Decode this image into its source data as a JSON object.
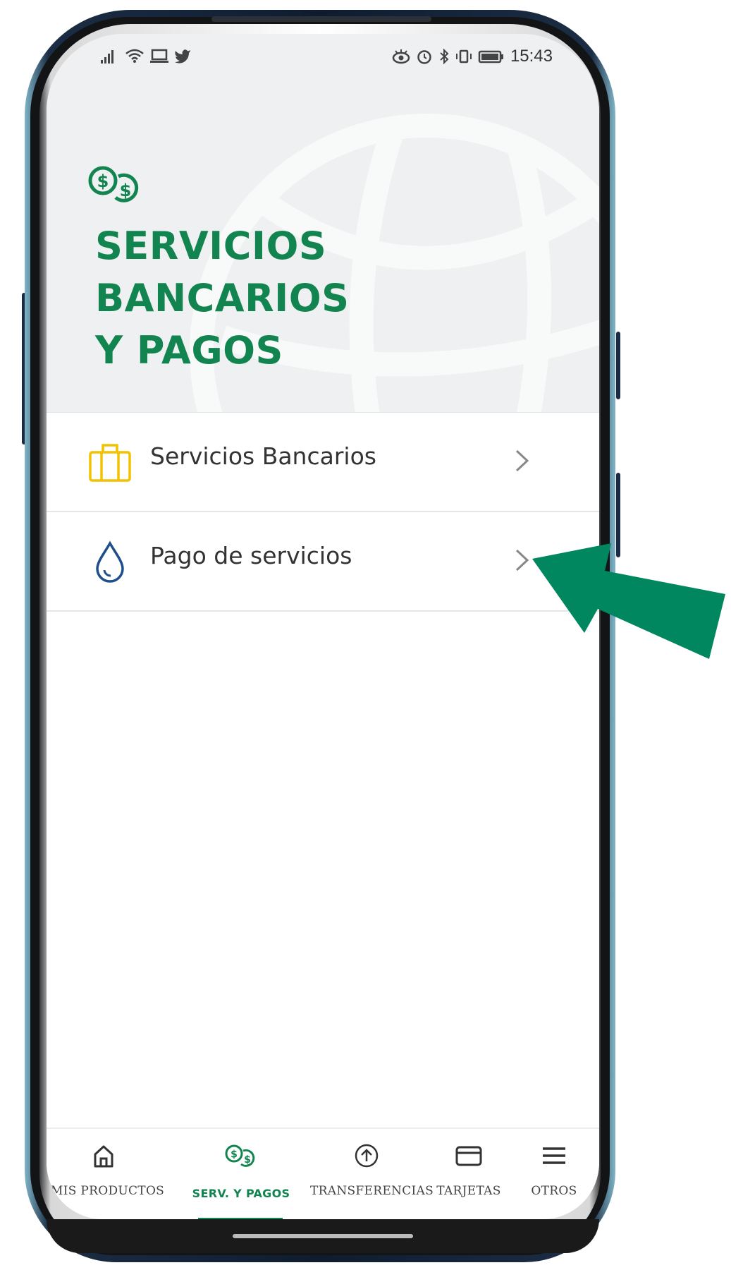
{
  "status_bar": {
    "time": "15:43"
  },
  "hero": {
    "title_lines": [
      "SERVICIOS",
      "BANCARIOS",
      "Y PAGOS"
    ]
  },
  "menu": {
    "items": [
      {
        "label": "Servicios Bancarios",
        "icon": "briefcase-icon"
      },
      {
        "label": "Pago de servicios",
        "icon": "water-drop-icon"
      }
    ]
  },
  "bottom_nav": {
    "items": [
      {
        "label": "MIS PRODUCTOS",
        "icon": "home-icon",
        "active": false
      },
      {
        "label": "SERV. Y PAGOS",
        "icon": "coins-icon",
        "active": true
      },
      {
        "label": "TRANSFERENCIAS",
        "icon": "arrow-up-circle-icon",
        "active": false
      },
      {
        "label": "TARJETAS",
        "icon": "card-icon",
        "active": false
      },
      {
        "label": "OTROS",
        "icon": "menu-icon",
        "active": false
      }
    ]
  },
  "colors": {
    "brand_green": "#12844f",
    "briefcase_yellow": "#f2c200",
    "drop_blue": "#1f4f8a",
    "annotation_arrow": "#00875f"
  }
}
